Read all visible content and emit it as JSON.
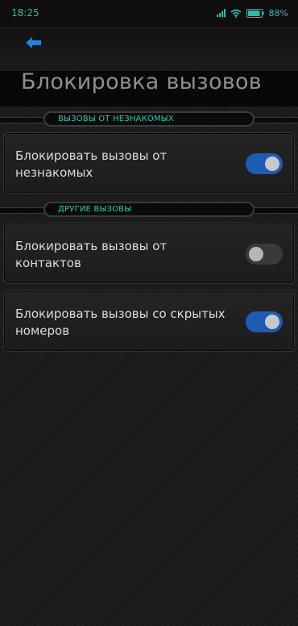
{
  "status_bar": {
    "time": "18:25",
    "battery_text": "88%",
    "accent_color": "#2fb9a8"
  },
  "toolbar": {
    "back_icon": "arrow-left-icon",
    "title": "Блокировка вызовов"
  },
  "sections": [
    {
      "header": "ВЫЗОВЫ ОТ НЕЗНАКОМЫХ",
      "items": [
        {
          "label": "Блокировать вызовы от незнакомых",
          "enabled": true
        }
      ]
    },
    {
      "header": "ДРУГИЕ ВЫЗОВЫ",
      "items": [
        {
          "label": "Блокировать вызовы от контактов",
          "enabled": false
        },
        {
          "label": "Блокировать вызовы со скрытых номеров",
          "enabled": true
        }
      ]
    }
  ],
  "colors": {
    "toggle_on": "#1d5bb5",
    "section_header_text": "#2fc7b0"
  }
}
